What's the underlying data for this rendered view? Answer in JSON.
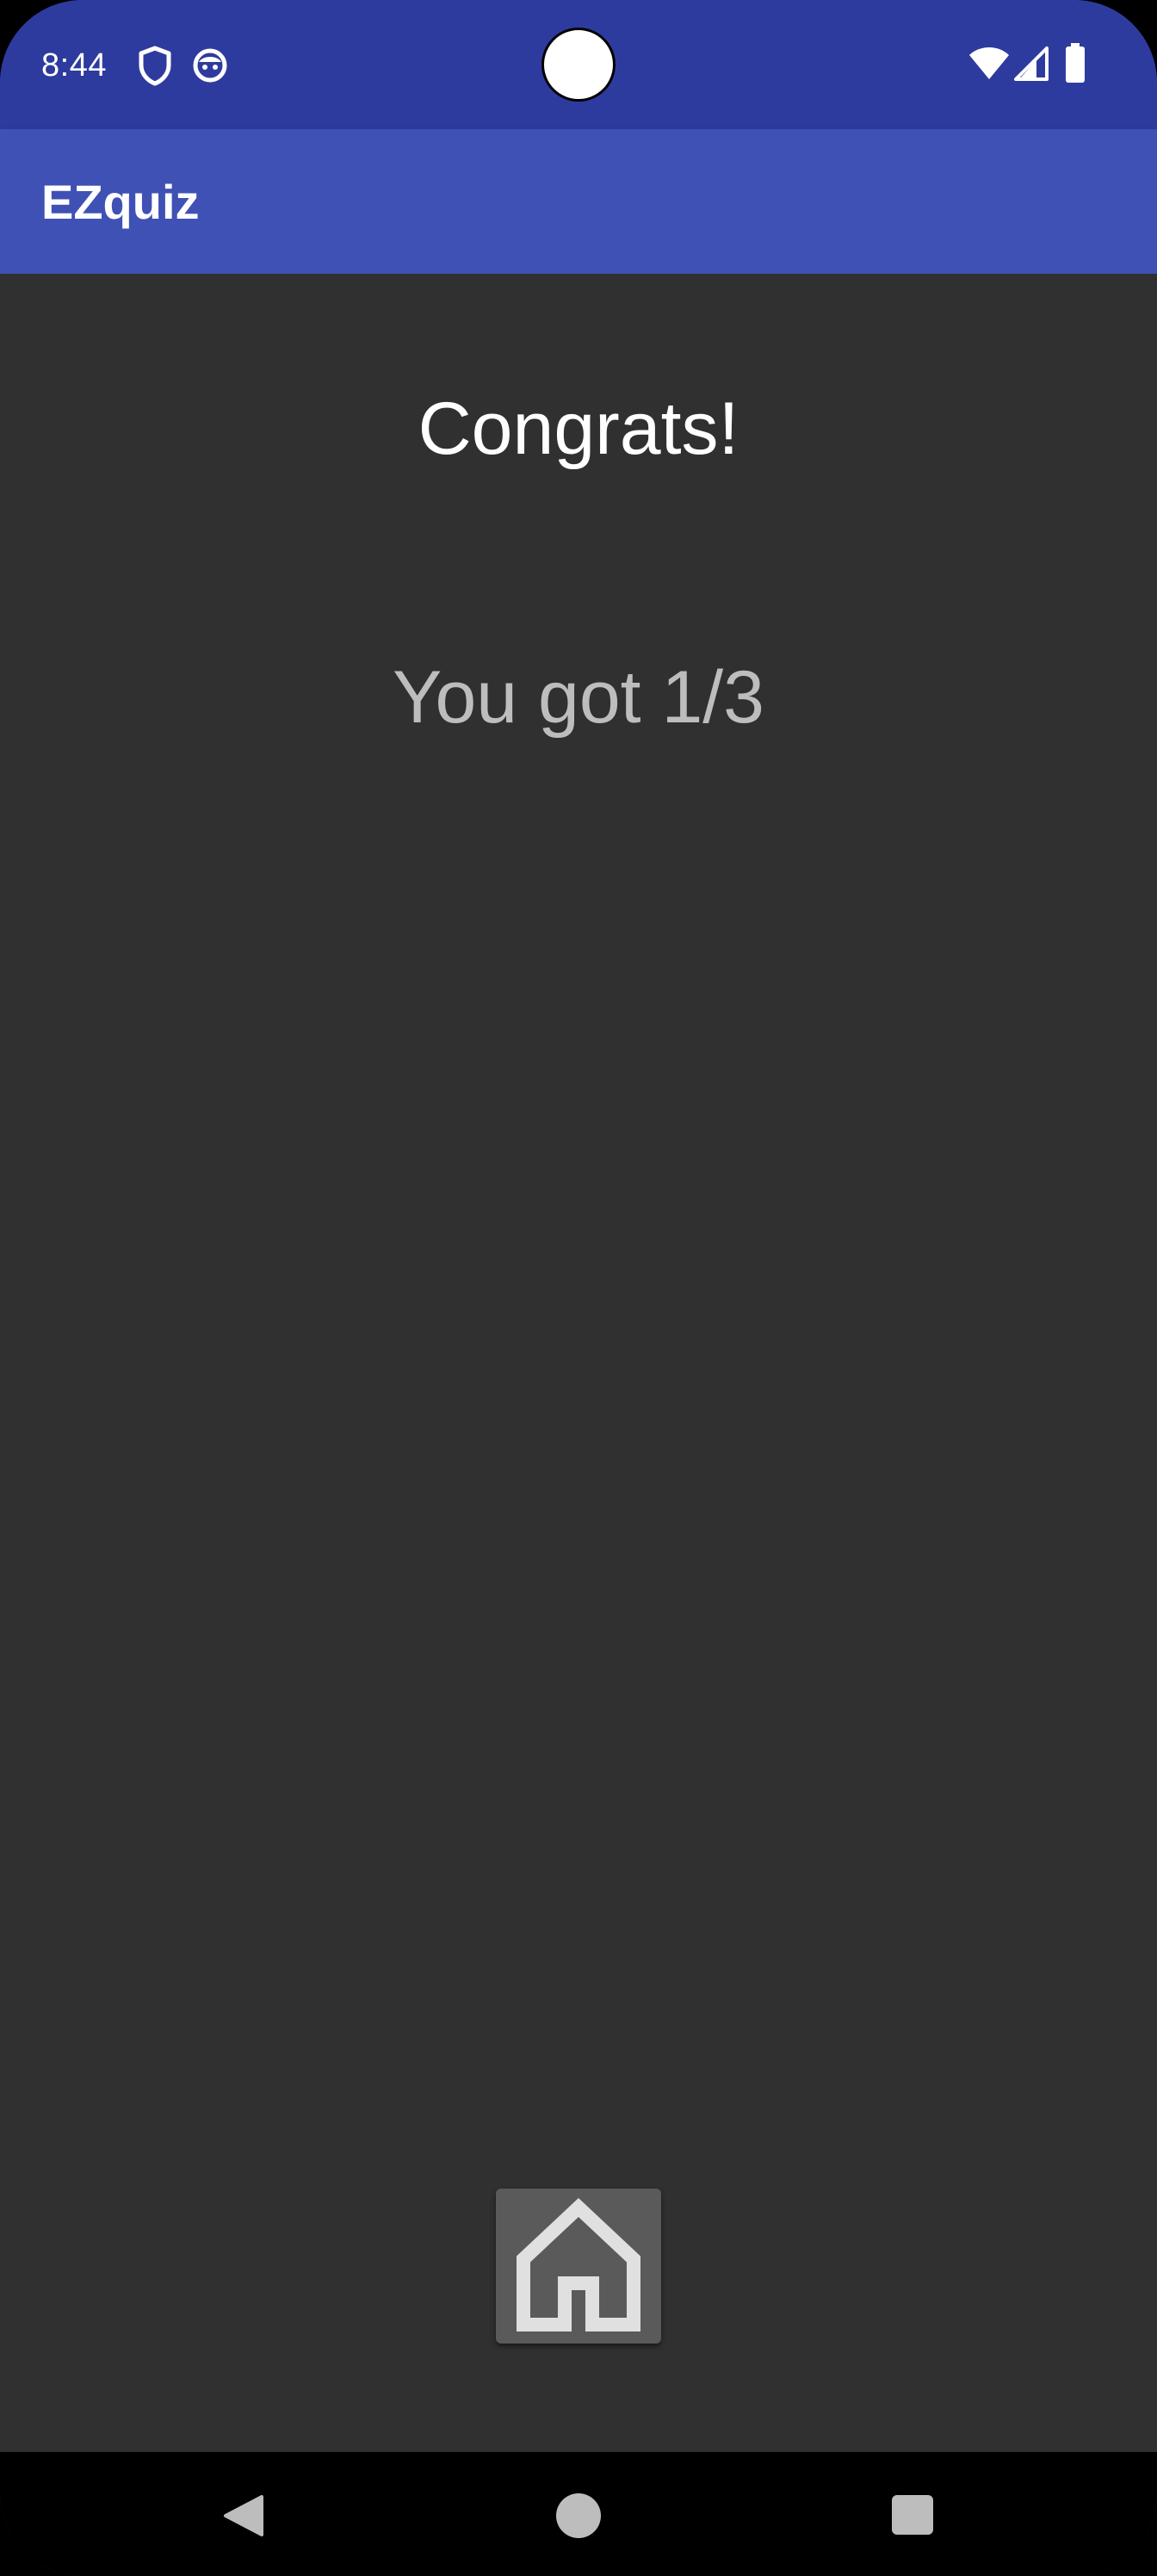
{
  "status_bar": {
    "time": "8:44",
    "icons": [
      "shield-icon",
      "face-icon",
      "wifi-icon",
      "signal-icon",
      "battery-icon"
    ],
    "background": "#2E3B9E"
  },
  "app_bar": {
    "title": "EZquiz",
    "background": "#3F51B5"
  },
  "result": {
    "headline": "Congrats!",
    "score_text": "You got 1/3"
  },
  "home_button": {
    "icon": "home-icon"
  },
  "nav_bar": {
    "buttons": [
      "back-icon",
      "home-icon",
      "recents-icon"
    ]
  },
  "colors": {
    "content_background": "#303030",
    "headline_text": "#FFFFFF",
    "score_text": "#BDBDBD"
  }
}
